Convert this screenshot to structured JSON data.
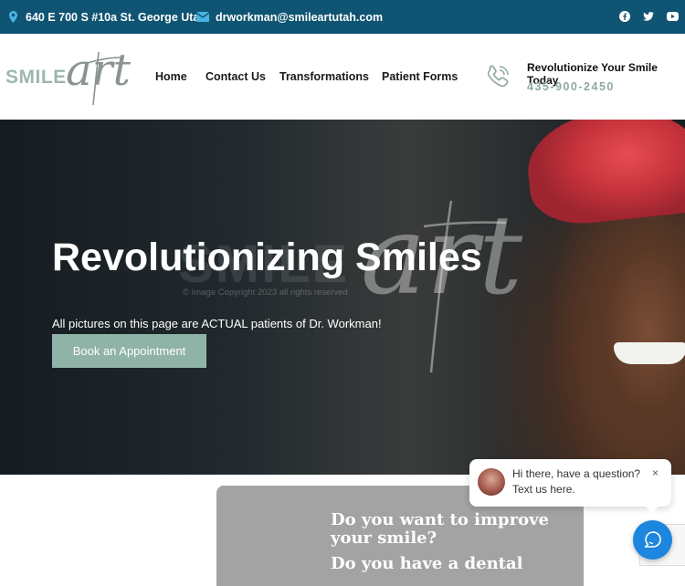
{
  "topbar": {
    "address": "640 E 700 S #10a St. George Utah",
    "email": "drworkman@smileartutah.com",
    "social_icons": [
      "facebook-icon",
      "twitter-icon",
      "youtube-icon"
    ],
    "background": "#0f5472"
  },
  "logo": {
    "word1": "SMILE",
    "word2": "art"
  },
  "nav": {
    "items": [
      "Home",
      "Contact Us",
      "Transformations",
      "Patient Forms"
    ]
  },
  "header_cta": {
    "title": "Revolutionize Your Smile Today",
    "phone": "435-900-2450",
    "accent": "#8fa9a3"
  },
  "hero": {
    "title": "Revolutionizing Smiles",
    "watermark_smile": "SMILE",
    "watermark_art": "art",
    "watermark_copyright": "© Image Copyright 2023 all rights reserved",
    "subtitle": "All pictures on this page are ACTUAL patients of Dr. Workman!",
    "button_label": "Book an Appointment",
    "button_color": "#8fb3a7"
  },
  "card": {
    "question1": "Do you want to improve your smile?",
    "question2": "Do you have a dental"
  },
  "chat": {
    "line1": "Hi there, have a question?",
    "line2": "Text us here.",
    "close": "×",
    "fab_color": "#1d86de"
  }
}
